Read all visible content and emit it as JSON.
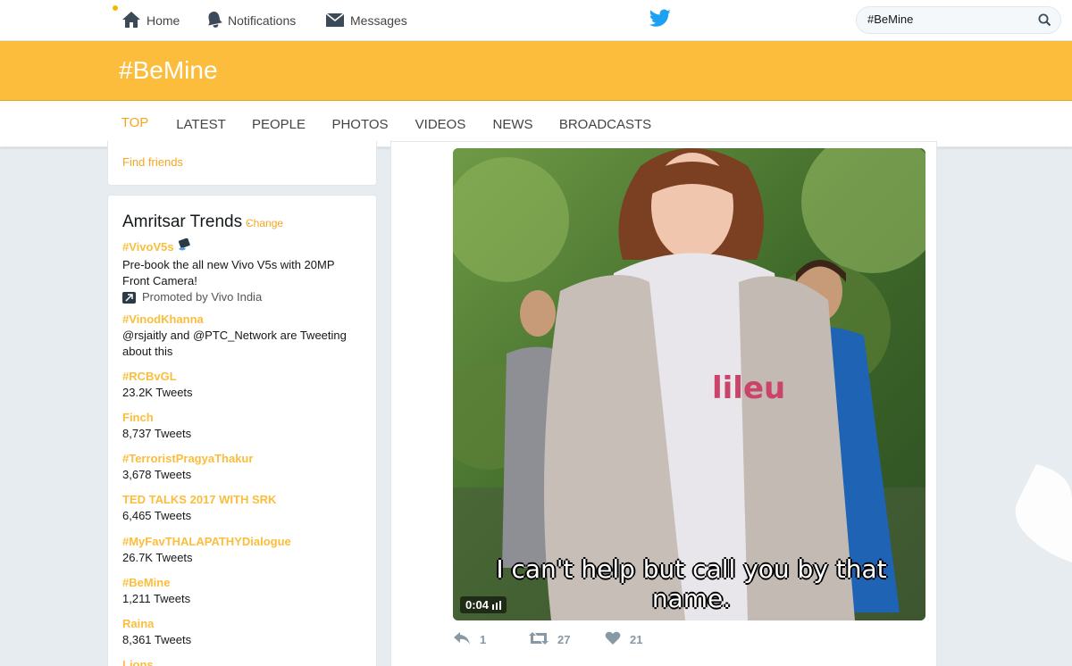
{
  "nav": {
    "home": "Home",
    "notifications": "Notifications",
    "messages": "Messages",
    "search_value": "#BeMine"
  },
  "header": {
    "title": "#BeMine"
  },
  "tabs": [
    "TOP",
    "LATEST",
    "PEOPLE",
    "PHOTOS",
    "VIDEOS",
    "NEWS",
    "BROADCASTS"
  ],
  "active_tab": "TOP",
  "sidebar": {
    "find_friends": "Find friends",
    "trends_title": "Amritsar Trends",
    "trends_separator": "·",
    "trends_change": "Change",
    "trends": [
      {
        "name": "#VivoV5s",
        "meta": "Pre-book the all new Vivo V5s with 20MP Front Camera!",
        "promoted": "Promoted by Vivo India"
      },
      {
        "name": "#VinodKhanna",
        "meta": "@rsjaitly and @PTC_Network are Tweeting about this"
      },
      {
        "name": "#RCBvGL",
        "meta": "23.2K Tweets"
      },
      {
        "name": "Finch",
        "meta": "8,737 Tweets"
      },
      {
        "name": "#TerroristPragyaThakur",
        "meta": "3,678 Tweets"
      },
      {
        "name": "TED TALKS 2017 WITH SRK",
        "meta": "6,465 Tweets"
      },
      {
        "name": "#MyFavTHALAPATHYDialogue",
        "meta": "26.7K Tweets"
      },
      {
        "name": "#BeMine",
        "meta": "1,211 Tweets"
      },
      {
        "name": "Raina",
        "meta": "8,361 Tweets"
      },
      {
        "name": "Lions",
        "meta": ""
      }
    ]
  },
  "tweet": {
    "video_time": "0:04",
    "subtitle": "I can't help but call you by that name.",
    "shirt_text": "lileu",
    "reply_count": "1",
    "retweet_count": "27",
    "like_count": "21"
  },
  "colors": {
    "accent": "#f5a623",
    "header_bg": "#fbbd3b",
    "trend_name": "#fbbd3b"
  }
}
